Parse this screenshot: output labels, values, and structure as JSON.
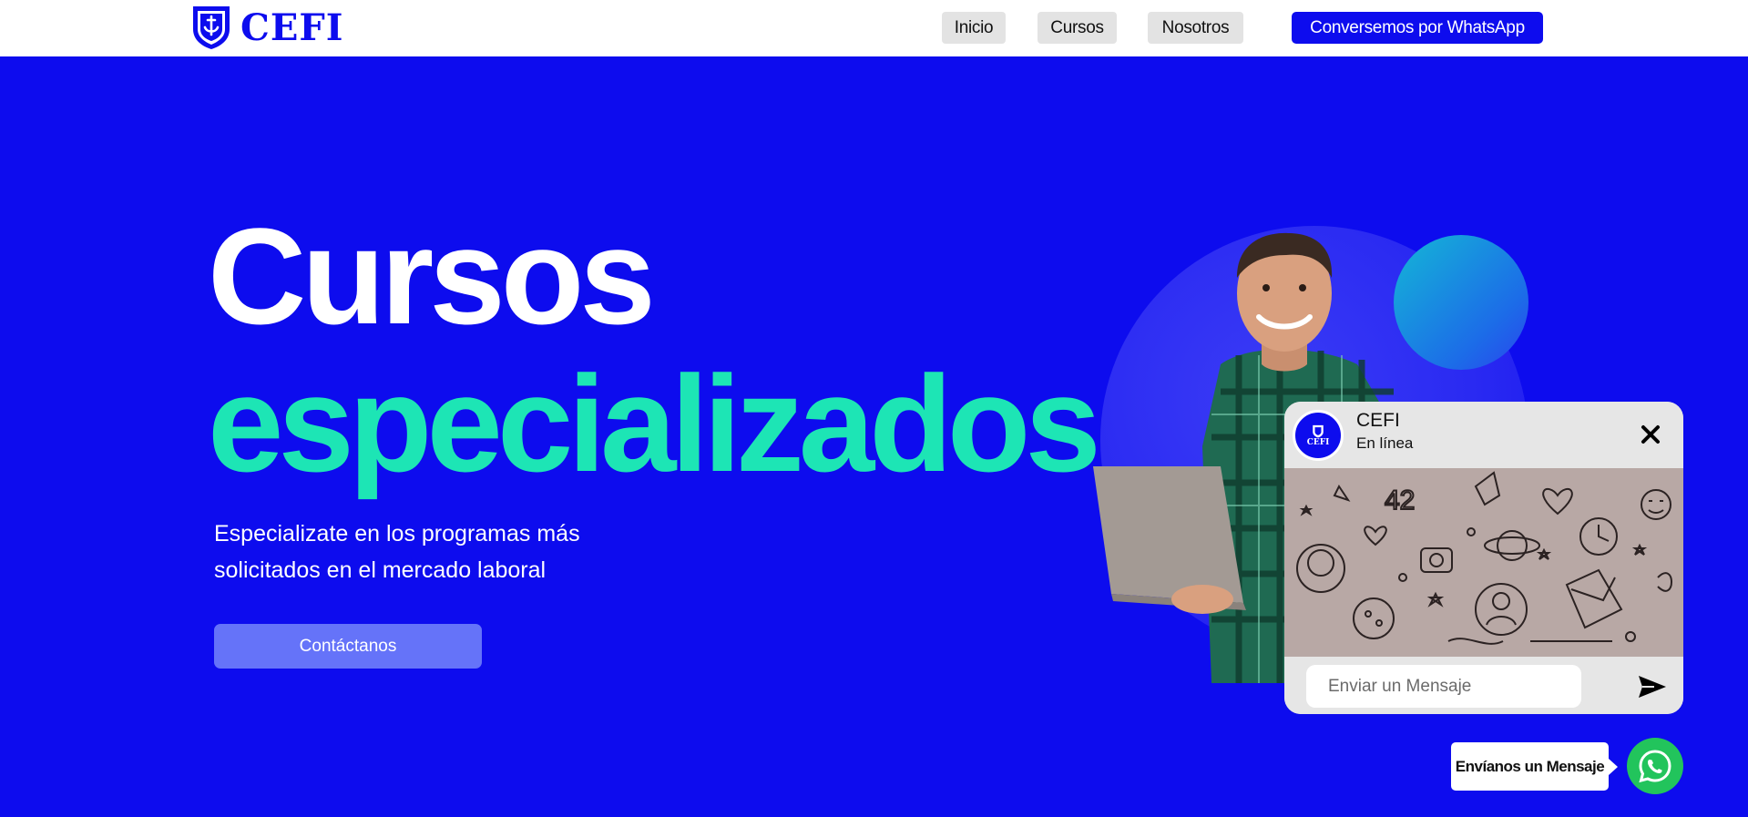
{
  "header": {
    "logo_text": "CEFI",
    "nav": {
      "inicio": "Inicio",
      "cursos": "Cursos",
      "nosotros": "Nosotros",
      "whatsapp": "Conversemos por WhatsApp"
    }
  },
  "hero": {
    "title_line1": "Cursos",
    "title_line2": "especializados",
    "subtitle": "Especializate en los programas más solicitados en el mercado laboral",
    "cta_label": "Contáctanos"
  },
  "chat": {
    "avatar_text": "CEFI",
    "name": "CEFI",
    "status": "En línea",
    "input_placeholder": "Enviar un Mensaje",
    "icons": [
      "close-icon",
      "send-icon"
    ]
  },
  "whatsapp_float": {
    "label": "Envíanos un Mensaje",
    "icon": "whatsapp-icon"
  },
  "colors": {
    "brand_blue": "#0d0cee",
    "accent_green": "#1de5b5",
    "cta_blue": "#6573f9",
    "whatsapp_green": "#22c45c"
  }
}
